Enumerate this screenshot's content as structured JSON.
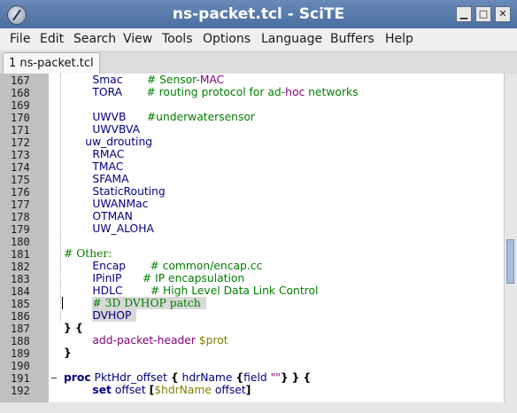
{
  "window": {
    "title": "ns-packet.tcl - SciTE",
    "buttons": {
      "minimize": "▁",
      "maximize": "□",
      "close": "✕"
    }
  },
  "menu": [
    "File",
    "Edit",
    "Search",
    "View",
    "Tools",
    "Options",
    "Language",
    "Buffers",
    "Help"
  ],
  "tab": {
    "label": "1 ns-packet.tcl"
  },
  "lines": [
    {
      "num": "167",
      "indent": 4,
      "parts": [
        [
          "id",
          "Smac"
        ],
        [
          "pad",
          "       "
        ],
        [
          "cmt",
          "# Sensor-"
        ],
        [
          "mac",
          "MAC"
        ]
      ]
    },
    {
      "num": "168",
      "indent": 4,
      "parts": [
        [
          "id",
          "TORA"
        ],
        [
          "pad",
          "       "
        ],
        [
          "cmt",
          "# routing protocol for ad-"
        ],
        [
          "mac",
          "hoc"
        ],
        [
          "cmt",
          " networks"
        ]
      ]
    },
    {
      "num": "169",
      "indent": 0,
      "parts": []
    },
    {
      "num": "170",
      "indent": 4,
      "parts": [
        [
          "id",
          "UWVB"
        ],
        [
          "pad",
          "      "
        ],
        [
          "cmt",
          "#underwatersensor"
        ]
      ]
    },
    {
      "num": "171",
      "indent": 4,
      "parts": [
        [
          "id",
          "UWVBVA"
        ]
      ]
    },
    {
      "num": "172",
      "indent": 3,
      "parts": [
        [
          "id",
          "uw_drouting"
        ]
      ]
    },
    {
      "num": "173",
      "indent": 4,
      "parts": [
        [
          "id",
          "RMAC"
        ]
      ]
    },
    {
      "num": "174",
      "indent": 4,
      "parts": [
        [
          "id",
          "TMAC"
        ]
      ]
    },
    {
      "num": "175",
      "indent": 4,
      "parts": [
        [
          "id",
          "SFAMA"
        ]
      ]
    },
    {
      "num": "176",
      "indent": 4,
      "parts": [
        [
          "id",
          "StaticRouting"
        ]
      ]
    },
    {
      "num": "177",
      "indent": 4,
      "parts": [
        [
          "id",
          "UWANMac"
        ]
      ]
    },
    {
      "num": "178",
      "indent": 4,
      "parts": [
        [
          "id",
          "OTMAN"
        ]
      ]
    },
    {
      "num": "179",
      "indent": 4,
      "parts": [
        [
          "id",
          "UW_ALOHA"
        ]
      ]
    },
    {
      "num": "180",
      "indent": 0,
      "parts": []
    },
    {
      "num": "181",
      "indent": 0,
      "parts": [
        [
          "com",
          "# Other:"
        ]
      ]
    },
    {
      "num": "182",
      "indent": 4,
      "parts": [
        [
          "id",
          "Encap"
        ],
        [
          "pad",
          "       "
        ],
        [
          "cmt",
          "# common/encap.cc"
        ]
      ]
    },
    {
      "num": "183",
      "indent": 4,
      "parts": [
        [
          "id",
          "IPinIP"
        ],
        [
          "pad",
          "      "
        ],
        [
          "cmt",
          "# IP encapsulation"
        ]
      ]
    },
    {
      "num": "184",
      "indent": 4,
      "parts": [
        [
          "id",
          "HDLC"
        ],
        [
          "pad",
          "        "
        ],
        [
          "cmt",
          "# High Level Data Link Control"
        ]
      ]
    },
    {
      "num": "185",
      "indent": 4,
      "hl": true,
      "parts": [
        [
          "com",
          "# 3D DVHOP patch"
        ]
      ]
    },
    {
      "num": "186",
      "indent": 4,
      "hl": true,
      "parts": [
        [
          "id",
          "DVHOP"
        ]
      ]
    },
    {
      "num": "187",
      "indent": 0,
      "parts": [
        [
          "op",
          "} {"
        ]
      ]
    },
    {
      "num": "188",
      "indent": 4,
      "parts": [
        [
          "mac",
          "add-packet-header"
        ],
        [
          "pad",
          " "
        ],
        [
          "var",
          "$prot"
        ]
      ]
    },
    {
      "num": "189",
      "indent": 0,
      "parts": [
        [
          "op",
          "}"
        ]
      ]
    },
    {
      "num": "190",
      "indent": 0,
      "parts": []
    },
    {
      "num": "191",
      "indent": 0,
      "parts": [
        [
          "kw",
          "proc"
        ],
        [
          "pad",
          " "
        ],
        [
          "id",
          "PktHdr_offset"
        ],
        [
          "pad",
          " "
        ],
        [
          "op",
          "{"
        ],
        [
          "pad",
          " "
        ],
        [
          "id",
          "hdrName"
        ],
        [
          "pad",
          " "
        ],
        [
          "op",
          "{"
        ],
        [
          "id",
          "field"
        ],
        [
          "pad",
          " "
        ],
        [
          "str",
          "\"\""
        ],
        [
          "op",
          "}"
        ],
        [
          "pad",
          " "
        ],
        [
          "op",
          "}"
        ],
        [
          "pad",
          " "
        ],
        [
          "op",
          "{"
        ]
      ]
    },
    {
      "num": "192",
      "indent": 4,
      "parts": [
        [
          "kw",
          "set"
        ],
        [
          "pad",
          " "
        ],
        [
          "id",
          "offset"
        ],
        [
          "pad",
          " "
        ],
        [
          "op",
          "["
        ],
        [
          "var",
          "$hdrName"
        ],
        [
          "pad",
          " "
        ],
        [
          "id",
          "offset"
        ],
        [
          "op",
          "]"
        ]
      ]
    }
  ]
}
